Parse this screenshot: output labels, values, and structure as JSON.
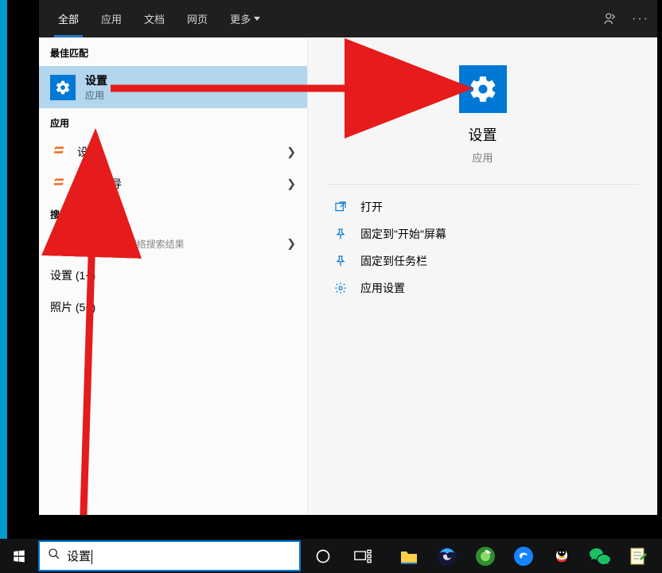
{
  "tabs": {
    "all": "全部",
    "apps": "应用",
    "docs": "文档",
    "web": "网页",
    "more": "更多"
  },
  "sections": {
    "best_match": "最佳匹配",
    "apps": "应用",
    "search_web": "搜索网页"
  },
  "best_match_item": {
    "title": "设置",
    "subtitle": "应用"
  },
  "app_items": [
    {
      "title": "设置"
    },
    {
      "title": "设置向导"
    }
  ],
  "web_item": {
    "title": "设置",
    "suffix": " - 查看网络搜索结果"
  },
  "result_lines": {
    "settings_count": "设置 (1+)",
    "photos_count": "照片 (5+)"
  },
  "preview": {
    "title": "设置",
    "subtitle": "应用",
    "actions": {
      "open": "打开",
      "pin_start": "固定到\"开始\"屏幕",
      "pin_taskbar": "固定到任务栏",
      "app_settings": "应用设置"
    }
  },
  "searchbox": {
    "query": "设置"
  }
}
